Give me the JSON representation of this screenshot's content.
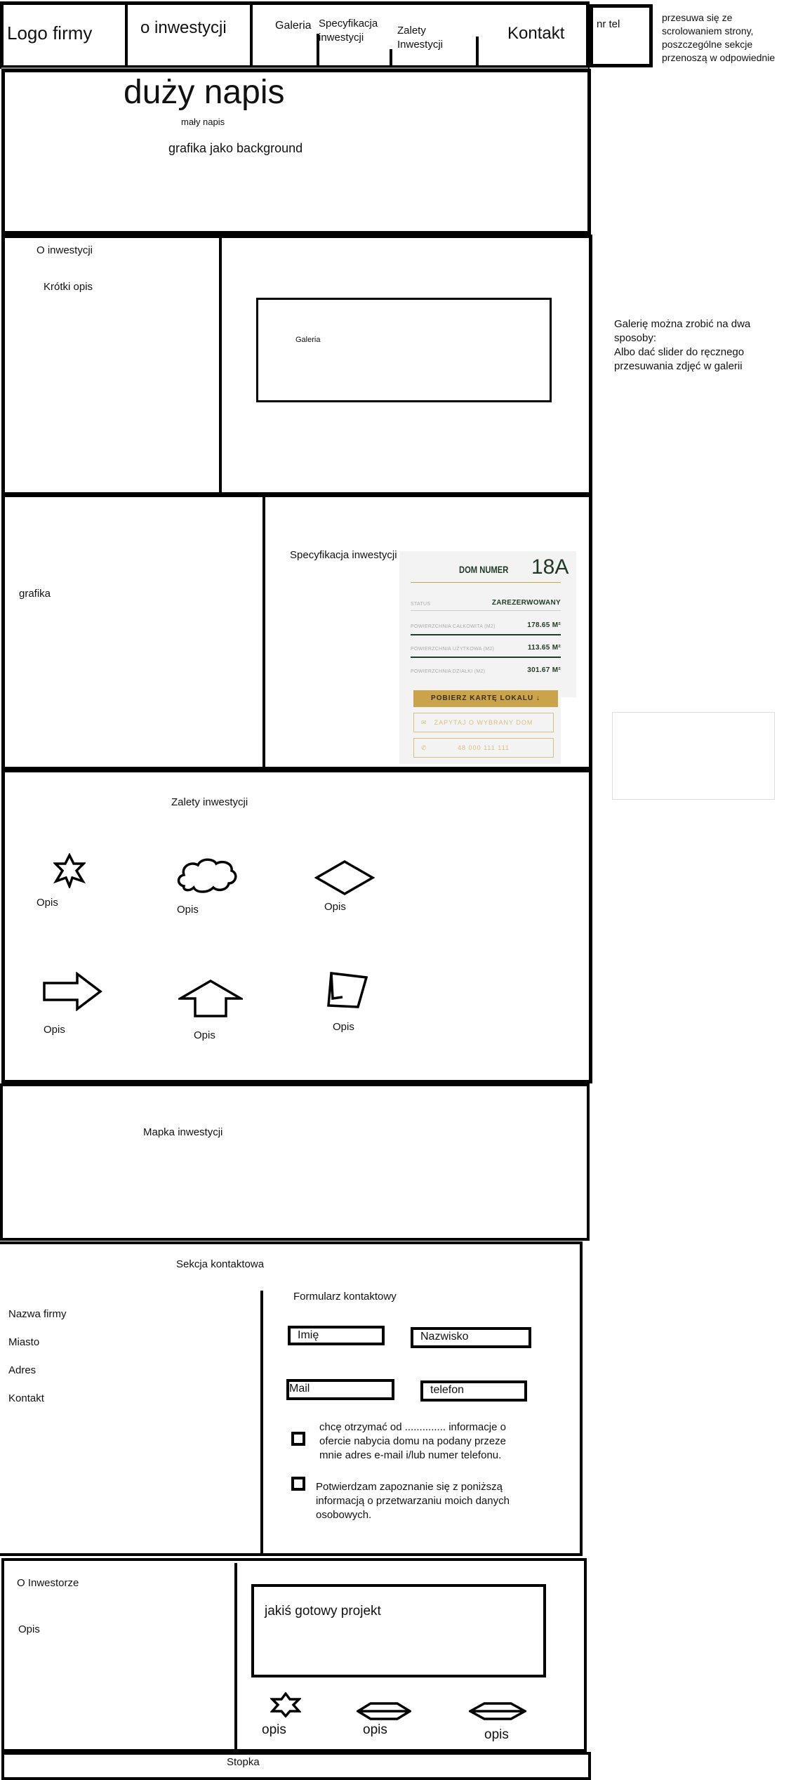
{
  "header": {
    "logo": "Logo firmy",
    "nav": [
      "o inwestycji",
      "Galeria",
      "Specyfikacja\ninwestycji",
      "Zalety\nInwestycji",
      "Kontakt"
    ],
    "phone": "nr tel",
    "note": "przesuwa się ze scrolowaniem strony, poszczególne sekcje przenoszą w odpowiednie miejsce na stronie"
  },
  "hero": {
    "big_title": "duży napis",
    "small_title": "mały napis",
    "background_note": "grafika jako background"
  },
  "about": {
    "title": "O inwestycji",
    "short_desc": "Krótki opis",
    "gallery": "Galeria",
    "gallery_note": "Galerię można zrobić na dwa sposoby:\nAlbo dać slider do ręcznego przesuwania zdjęć w galerii"
  },
  "spec": {
    "graphic": "grafika",
    "title": "Specyfikacja inwestycji",
    "card": {
      "heading": "DOM NUMER",
      "number": "18A",
      "rows": [
        {
          "label": "STATUS",
          "value": "ZAREZERWOWANY"
        },
        {
          "label": "POWIERZCHNIA CAŁKOWITA (M2)",
          "value": "178.65 M²"
        },
        {
          "label": "POWIERZCHNIA UŻYTKOWA (M2)",
          "value": "113.65 M²"
        },
        {
          "label": "POWIERZCHNIA DZIAŁKI (M2)",
          "value": "301.67 M²"
        }
      ],
      "download": "POBIERZ KARTĘ LOKALU",
      "ask": "ZAPYTAJ O WYBRANY DOM",
      "phone": "48 000 111 111"
    }
  },
  "advantages": {
    "title": "Zalety inwestycji",
    "items": [
      "Opis",
      "Opis",
      "Opis",
      "Opis",
      "Opis",
      "Opis"
    ]
  },
  "map": {
    "title": "Mapka inwestycji"
  },
  "contact": {
    "title": "Sekcja kontaktowa",
    "company": [
      "Nazwa firmy",
      "Miasto",
      "Adres",
      "Kontakt"
    ],
    "form_title": "Formularz kontaktowy",
    "fields": {
      "first_name": "Imię",
      "last_name": "Nazwisko",
      "mail": "Mail",
      "phone": "telefon"
    },
    "consent1": "chcę otrzymać od .............. informacje o ofercie nabycia domu na podany przeze mnie adres e-mail i/lub numer telefonu.",
    "consent2": "Potwierdzam zapoznanie się z poniższą informacją o przetwarzaniu moich danych osobowych."
  },
  "investor": {
    "title": "O Inwestorze",
    "desc": "Opis",
    "project": "jakiś gotowy projekt",
    "items": [
      "opis",
      "opis",
      "opis"
    ]
  },
  "footer": {
    "label": "Stopka"
  }
}
